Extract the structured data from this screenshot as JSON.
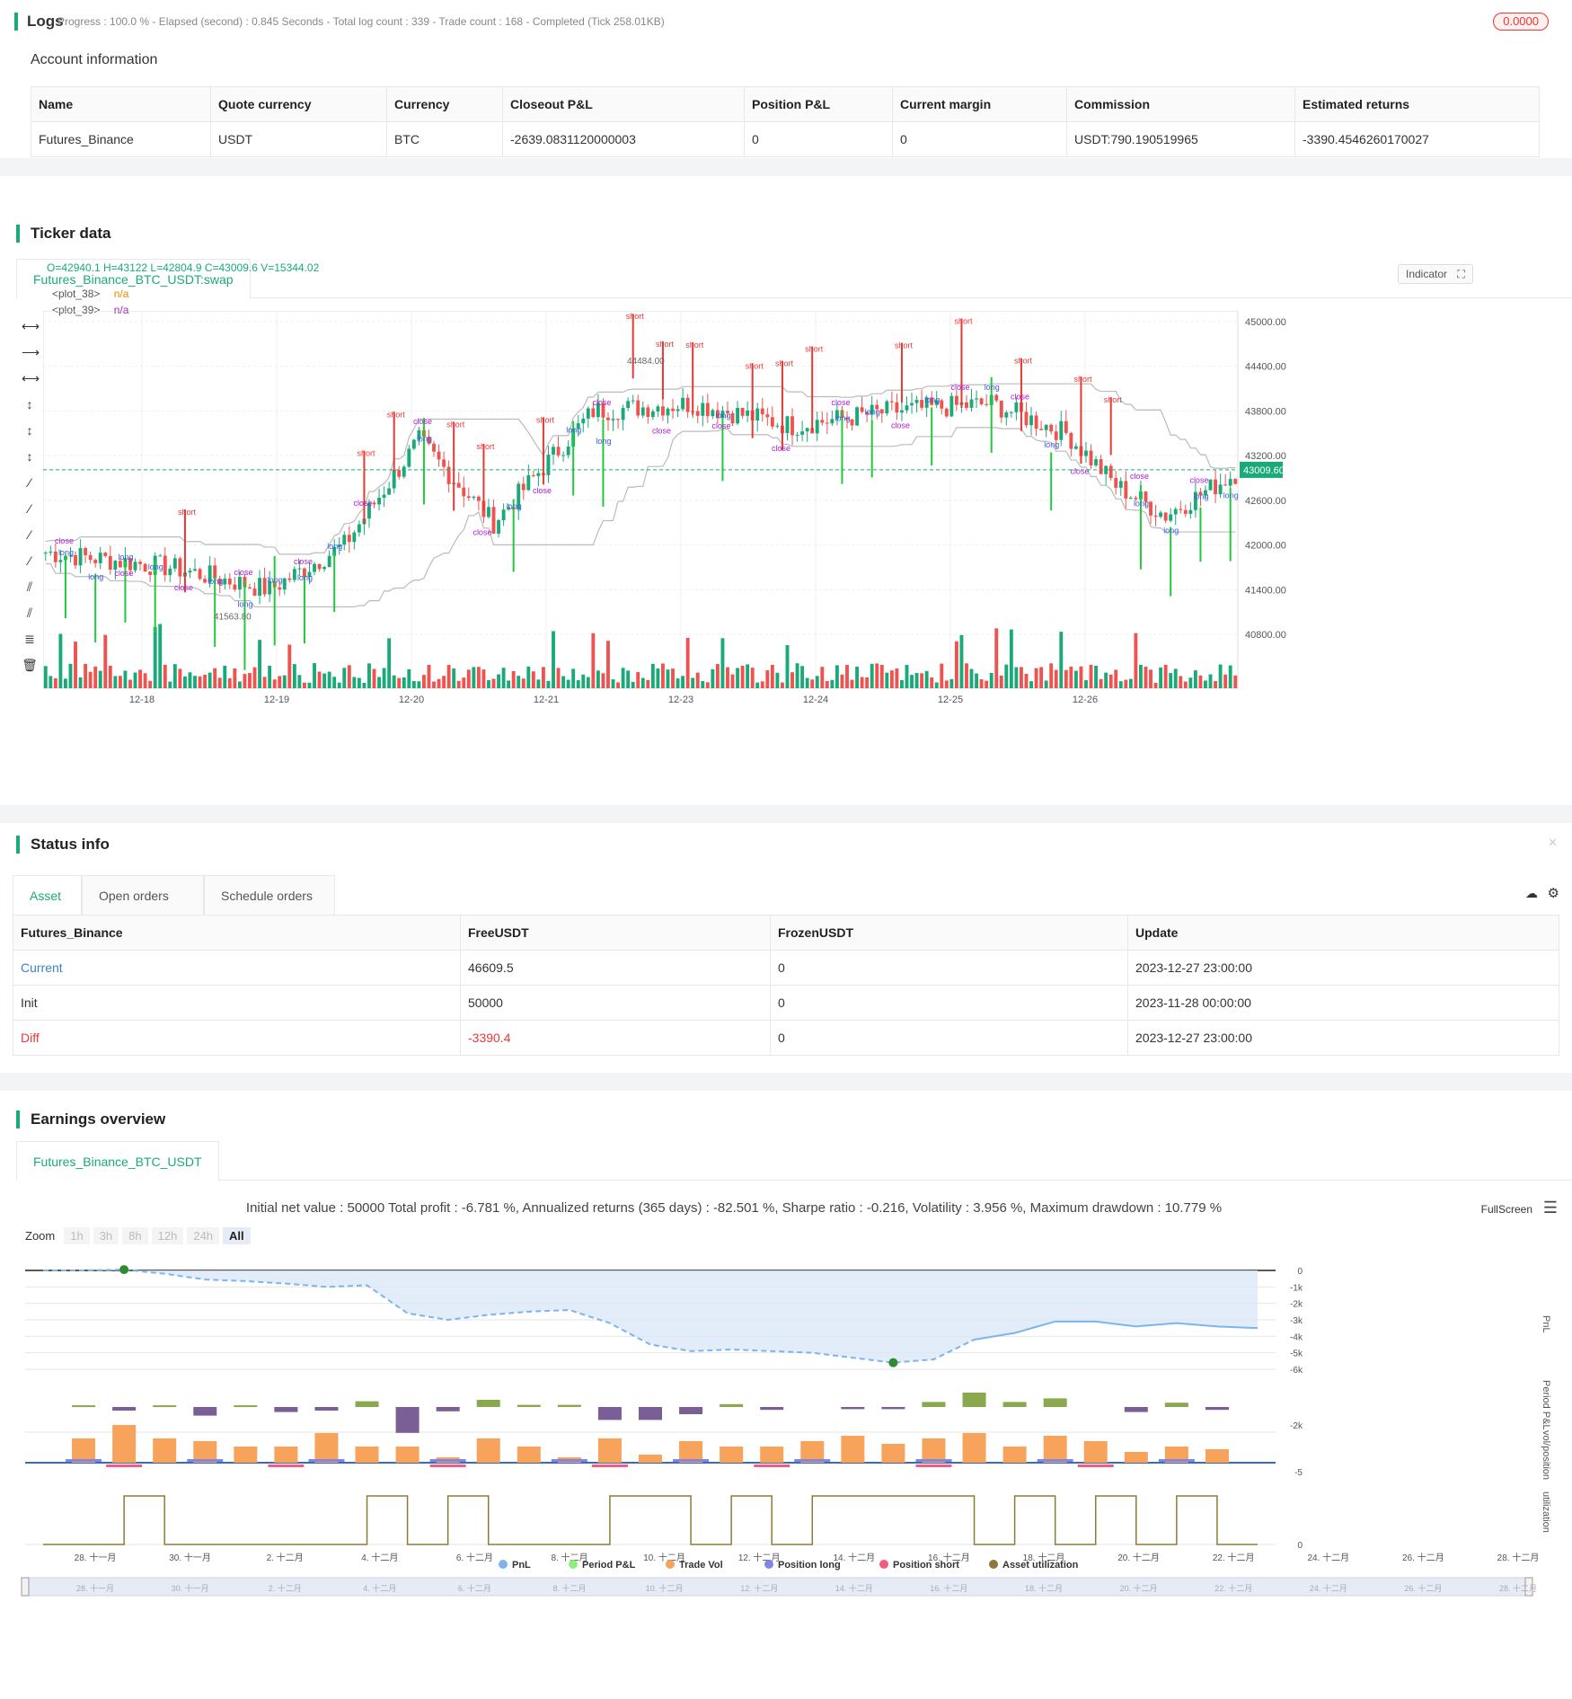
{
  "logs": {
    "title": "Logs",
    "status": "Progress : 100.0 % - Elapsed (second) : 0.845  Seconds - Total log count : 339 - Trade count : 168 - Completed (Tick 258.01KB)",
    "badge": "0.0000"
  },
  "account": {
    "title": "Account information",
    "headers": [
      "Name",
      "Quote currency",
      "Currency",
      "Closeout P&L",
      "Position P&L",
      "Current margin",
      "Commission",
      "Estimated returns"
    ],
    "row": [
      "Futures_Binance",
      "USDT",
      "BTC",
      "-2639.0831120000003",
      "0",
      "0",
      "USDT:790.190519965",
      "-3390.4546260170027"
    ]
  },
  "ticker": {
    "title": "Ticker data",
    "tab": "Futures_Binance_BTC_USDT:swap",
    "ohlc": "O=42940.1 H=43122 L=42804.9 C=43009.6 V=15344.02",
    "legend": [
      {
        "name": "<plot_38>",
        "value": "n/a"
      },
      {
        "name": "<plot_39>",
        "value": "n/a"
      }
    ],
    "indicator_btn": "Indicator",
    "price_ticks": [
      "45000.00",
      "44400.00",
      "43800.00",
      "43200.00",
      "42600.00",
      "42000.00",
      "41400.00",
      "40800.00"
    ],
    "current_price": "43009.60",
    "high_label": "44484.00",
    "low_label": "41563.80",
    "date_ticks": [
      "12-18",
      "12-19",
      "12-20",
      "12-21",
      "12-23",
      "12-24",
      "12-25",
      "12-26"
    ]
  },
  "status": {
    "title": "Status info",
    "tabs": [
      "Asset",
      "Open orders",
      "Schedule orders"
    ],
    "headers": [
      "Futures_Binance",
      "FreeUSDT",
      "FrozenUSDT",
      "Update"
    ],
    "rows": [
      [
        "Current",
        "46609.5",
        "0",
        "2023-12-27 23:00:00"
      ],
      [
        "Init",
        "50000",
        "0",
        "2023-11-28 00:00:00"
      ],
      [
        "Diff",
        "-3390.4",
        "0",
        "2023-12-27 23:00:00"
      ]
    ],
    "colors": {
      "current": "#3b82c4",
      "diff": "#e53935"
    }
  },
  "earnings": {
    "title": "Earnings overview",
    "tab": "Futures_Binance_BTC_USDT",
    "summary": "Initial net value : 50000 Total profit : -6.781 %, Annualized returns (365 days) : -82.501 %, Sharpe ratio : -0.216, Volatility : 3.956 %, Maximum drawdown : 10.779 %",
    "fullscreen": "FullScreen",
    "zoom_label": "Zoom",
    "zoom_buttons": [
      "1h",
      "3h",
      "8h",
      "12h",
      "24h",
      "All"
    ],
    "pnl_ticks": [
      "0",
      "-1k",
      "-2k",
      "-3k",
      "-4k",
      "-5k",
      "-6k"
    ],
    "pnl_axis": "PnL",
    "period_axis": "Period P&L",
    "period_tick": "-2k",
    "vol_axis": "vol/position",
    "vol_tick": "-5",
    "util_axis": "utilization",
    "util_tick": "0",
    "date_ticks": [
      "28. 十一月",
      "30. 十一月",
      "2. 十二月",
      "4. 十二月",
      "6. 十二月",
      "8. 十二月",
      "10. 十二月",
      "12. 十二月",
      "14. 十二月",
      "16. 十二月",
      "18. 十二月",
      "20. 十二月",
      "22. 十二月",
      "24. 十二月",
      "26. 十二月",
      "28. 十二月"
    ],
    "legend": [
      {
        "name": "PnL",
        "color": "#7cb5ec"
      },
      {
        "name": "Period P&L",
        "color": "#90ed7d"
      },
      {
        "name": "Trade Vol",
        "color": "#f7a35c"
      },
      {
        "name": "Position long",
        "color": "#8085e9"
      },
      {
        "name": "Position short",
        "color": "#f15c80"
      },
      {
        "name": "Asset utilization",
        "color": "#8d7a3a"
      }
    ]
  },
  "chart_data": {
    "type": "line",
    "x": [
      "28.11",
      "29.11",
      "30.11",
      "1.12",
      "2.12",
      "3.12",
      "4.12",
      "5.12",
      "6.12",
      "7.12",
      "8.12",
      "9.12",
      "10.12",
      "11.12",
      "12.12",
      "13.12",
      "14.12",
      "15.12",
      "16.12",
      "17.12",
      "18.12",
      "19.12",
      "20.12",
      "21.12",
      "22.12",
      "23.12",
      "24.12",
      "25.12",
      "26.12",
      "27.12",
      "28.12"
    ],
    "series": [
      {
        "name": "PnL",
        "values": [
          0,
          0,
          50,
          -200,
          -550,
          -650,
          -800,
          -1000,
          -900,
          -2600,
          -3000,
          -2700,
          -2500,
          -2400,
          -3200,
          -4500,
          -4900,
          -4800,
          -4900,
          -5000,
          -5300,
          -5600,
          -5400,
          -4200,
          -3800,
          -3100,
          -3100,
          -3400,
          -3200,
          -3400,
          -3500
        ]
      },
      {
        "name": "Period P&L",
        "values": [
          0,
          120,
          -250,
          120,
          -600,
          120,
          -350,
          -250,
          400,
          -1800,
          -300,
          500,
          150,
          150,
          -900,
          -900,
          -500,
          200,
          -200,
          0,
          -150,
          -150,
          350,
          1000,
          350,
          600,
          0,
          -350,
          300,
          -200,
          0
        ]
      },
      {
        "name": "Trade Vol",
        "values": [
          0,
          9,
          14,
          9,
          8,
          6,
          6,
          11,
          6,
          6,
          2,
          9,
          6,
          2,
          9,
          3,
          8,
          6,
          6,
          8,
          10,
          7,
          9,
          11,
          6,
          10,
          8,
          4,
          6,
          5,
          0
        ]
      },
      {
        "name": "Asset utilization",
        "values": [
          0,
          0,
          1,
          0,
          0,
          0,
          0,
          0,
          1,
          0,
          1,
          0,
          0,
          0,
          1,
          1,
          0,
          1,
          0,
          1,
          1,
          1,
          1,
          0,
          1,
          0,
          1,
          0,
          1,
          0,
          0
        ]
      }
    ],
    "ylabel": "PnL"
  }
}
